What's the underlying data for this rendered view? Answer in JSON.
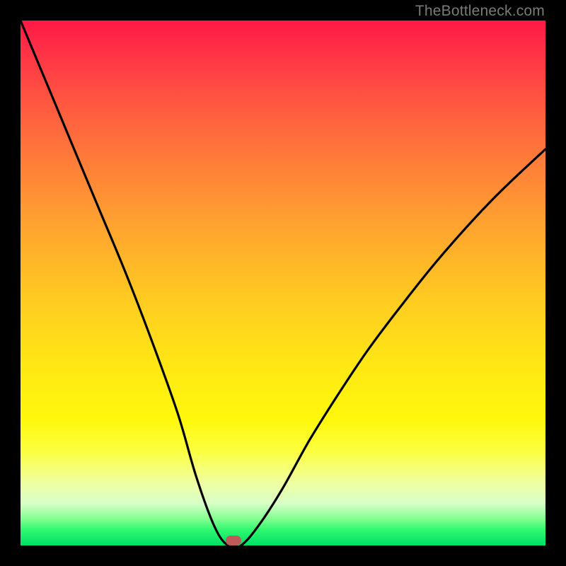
{
  "watermark": "TheBottleneck.com",
  "chart_data": {
    "type": "line",
    "title": "",
    "xlabel": "",
    "ylabel": "",
    "xlim": [
      0,
      1
    ],
    "ylim": [
      0,
      1
    ],
    "series": [
      {
        "name": "bottleneck-curve",
        "x": [
          0.0,
          0.05,
          0.1,
          0.15,
          0.2,
          0.25,
          0.3,
          0.335,
          0.37,
          0.395,
          0.42,
          0.455,
          0.5,
          0.55,
          0.6,
          0.66,
          0.72,
          0.8,
          0.9,
          1.0
        ],
        "y": [
          1.0,
          0.88,
          0.76,
          0.64,
          0.52,
          0.39,
          0.25,
          0.13,
          0.035,
          0.0,
          0.0,
          0.04,
          0.11,
          0.2,
          0.28,
          0.37,
          0.45,
          0.55,
          0.66,
          0.755
        ]
      }
    ],
    "marker": {
      "x": 0.405,
      "y": 0.01,
      "label": "optimal-point"
    },
    "background": {
      "type": "vertical-gradient",
      "stops": [
        {
          "pos": 0.0,
          "color": "#ff1846"
        },
        {
          "pos": 0.5,
          "color": "#ffc020"
        },
        {
          "pos": 0.82,
          "color": "#fcff40"
        },
        {
          "pos": 1.0,
          "color": "#00e066"
        }
      ]
    }
  }
}
